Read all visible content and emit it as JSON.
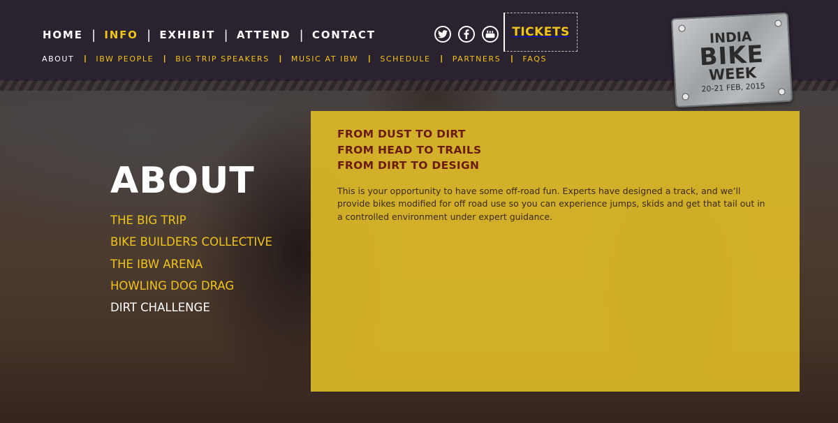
{
  "main_nav": [
    {
      "label": "HOME",
      "active": false
    },
    {
      "label": "INFO",
      "active": true
    },
    {
      "label": "EXHIBIT",
      "active": false
    },
    {
      "label": "ATTEND",
      "active": false
    },
    {
      "label": "CONTACT",
      "active": false
    }
  ],
  "sub_nav": [
    {
      "label": "ABOUT",
      "active": true
    },
    {
      "label": "IBW PEOPLE",
      "active": false
    },
    {
      "label": "BIG TRIP SPEAKERS",
      "active": false
    },
    {
      "label": "MUSIC AT IBW",
      "active": false
    },
    {
      "label": "SCHEDULE",
      "active": false
    },
    {
      "label": "PARTNERS",
      "active": false
    },
    {
      "label": "FAQS",
      "active": false
    }
  ],
  "social": [
    {
      "icon": "twitter-icon",
      "glyph": "t"
    },
    {
      "icon": "facebook-icon",
      "glyph": "f"
    },
    {
      "icon": "youtube-icon",
      "glyph": "▶"
    }
  ],
  "tickets_label": "TICKETS",
  "logo": {
    "line1": "INDIA",
    "line2": "BIKE",
    "line3": "WEEK",
    "dates": "20-21 FEB, 2015"
  },
  "page_title": "ABOUT",
  "side_menu": [
    {
      "label": "THE BIG TRIP",
      "active": false
    },
    {
      "label": "BIKE BUILDERS COLLECTIVE",
      "active": false
    },
    {
      "label": "THE IBW ARENA",
      "active": false
    },
    {
      "label": "HOWLING DOG DRAG",
      "active": false
    },
    {
      "label": "DIRT CHALLENGE",
      "active": true
    }
  ],
  "panel": {
    "tagline": [
      "FROM DUST TO DIRT",
      "FROM HEAD TO TRAILS",
      "FROM DIRT TO DESIGN"
    ],
    "body": "This is your opportunity to have some off-road fun. Experts have designed a track, and we’ll provide bikes modified for off road use so you can experience jumps, skids and get that tail out in a controlled environment under expert guidance."
  },
  "colors": {
    "accent": "#f0c419",
    "header_bg": "#2b2230",
    "panel_bg": "#deba28",
    "tagline": "#6a1b12"
  }
}
